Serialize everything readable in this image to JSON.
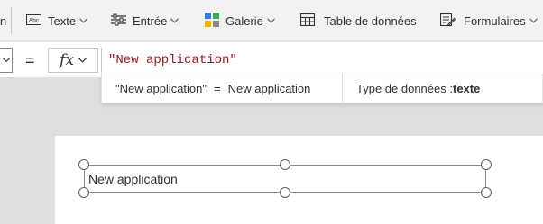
{
  "ribbon": {
    "truncated_left": "n",
    "items": [
      {
        "label": "Texte",
        "icon": "text-label-icon"
      },
      {
        "label": "Entrée",
        "icon": "input-sliders-icon"
      },
      {
        "label": "Galerie",
        "icon": "gallery-grid-icon"
      },
      {
        "label": "Table de données",
        "icon": "data-table-icon"
      },
      {
        "label": "Formulaires",
        "icon": "forms-icon"
      }
    ],
    "text_icon_label": "Abc"
  },
  "formula_bar": {
    "equals": "=",
    "fx_label": "fx",
    "formula": "\"New application\""
  },
  "result": {
    "expression": "\"New application\"",
    "equals": "=",
    "value": "New application",
    "type_label": "Type de données :",
    "type_value": "texte"
  },
  "canvas": {
    "label_text": "New application"
  },
  "colors": {
    "ribbon_bg": "#f3f2f1",
    "formula_text": "#a31515",
    "canvas_bg": "#ffffff",
    "workspace_bg": "#e1dfdd"
  }
}
